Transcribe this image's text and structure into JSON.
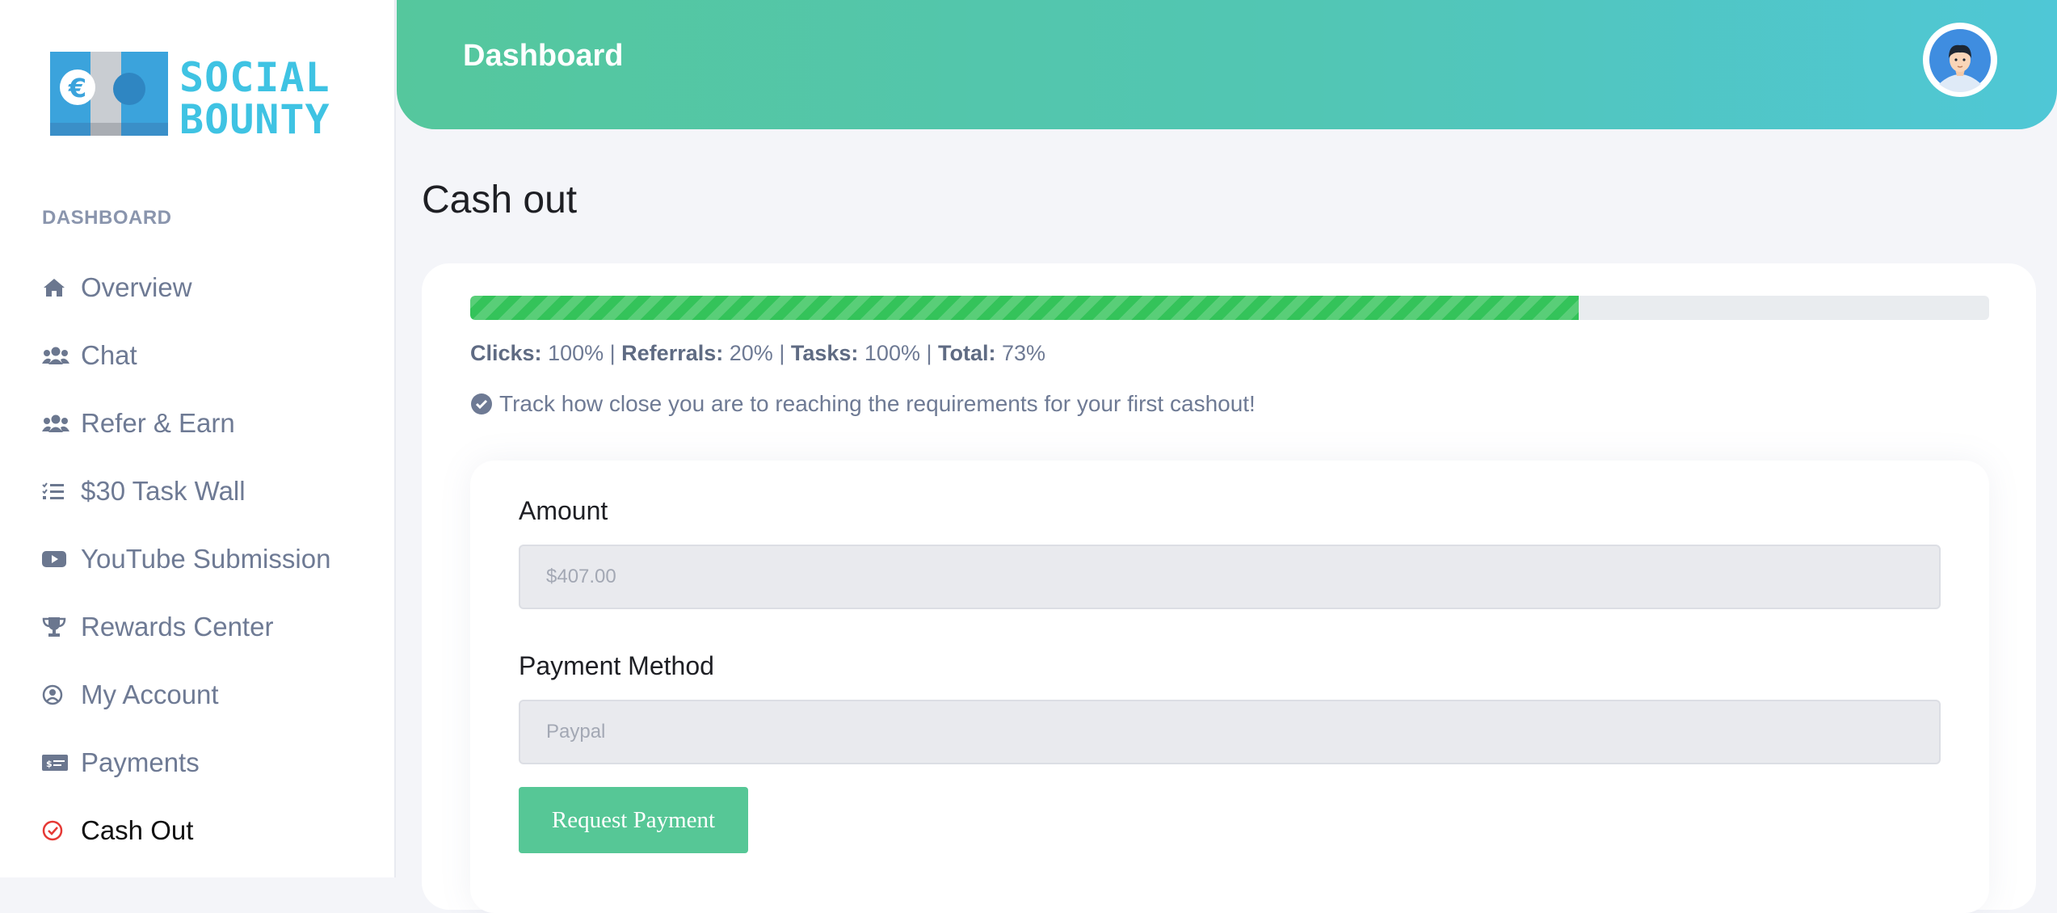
{
  "brand": {
    "line1": "SOCIAL",
    "line2": "BOUNTY",
    "color": "#3fc3e3"
  },
  "sidebar": {
    "section_label": "DASHBOARD",
    "items": [
      {
        "label": "Overview",
        "icon": "home-icon"
      },
      {
        "label": "Chat",
        "icon": "users-icon"
      },
      {
        "label": "Refer & Earn",
        "icon": "users-icon"
      },
      {
        "label": "$30 Task Wall",
        "icon": "tasks-list-icon"
      },
      {
        "label": "YouTube Submission",
        "icon": "youtube-icon"
      },
      {
        "label": "Rewards Center",
        "icon": "trophy-icon"
      },
      {
        "label": "My Account",
        "icon": "user-circle-icon"
      },
      {
        "label": "Payments",
        "icon": "money-check-icon"
      },
      {
        "label": "Cash Out",
        "icon": "check-circle-icon",
        "active": true
      }
    ]
  },
  "header": {
    "title": "Dashboard"
  },
  "main": {
    "title": "Cash out",
    "progress": {
      "percent": 73,
      "color": "#34c35a"
    },
    "stats": {
      "clicks_label": "Clicks:",
      "clicks_value": "100%",
      "referrals_label": "Referrals:",
      "referrals_value": "20%",
      "tasks_label": "Tasks:",
      "tasks_value": "100%",
      "total_label": "Total:",
      "total_value": "73%",
      "separator": "|"
    },
    "track_text": "Track how close you are to reaching the requirements for your first cashout!",
    "form": {
      "amount_label": "Amount",
      "amount_value": "$407.00",
      "method_label": "Payment Method",
      "method_value": "Paypal",
      "submit_label": "Request Payment"
    }
  },
  "colors": {
    "accent": "#56c796",
    "active_icon": "#e53935"
  }
}
